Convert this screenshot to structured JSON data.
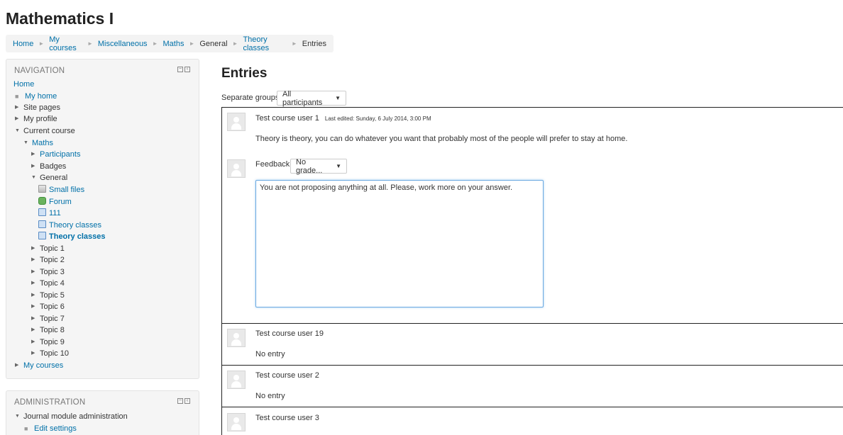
{
  "page_title": "Mathematics I",
  "breadcrumb": {
    "items": [
      "Home",
      "My courses",
      "Miscellaneous",
      "Maths",
      "General",
      "Theory classes",
      "Entries"
    ],
    "separator": "►"
  },
  "navigation": {
    "title": "NAVIGATION",
    "home": "Home",
    "my_home": "My home",
    "site_pages": "Site pages",
    "my_profile": "My profile",
    "current_course": "Current course",
    "maths": "Maths",
    "participants": "Participants",
    "badges": "Badges",
    "general": "General",
    "small_files": "Small files",
    "forum": "Forum",
    "item_111": "111",
    "theory_classes_1": "Theory classes",
    "theory_classes_2": "Theory classes",
    "topics": [
      "Topic 1",
      "Topic 2",
      "Topic 3",
      "Topic 4",
      "Topic 5",
      "Topic 6",
      "Topic 7",
      "Topic 8",
      "Topic 9",
      "Topic 10"
    ],
    "my_courses": "My courses"
  },
  "administration": {
    "title": "ADMINISTRATION",
    "journal_admin": "Journal module administration",
    "edit_settings": "Edit settings"
  },
  "main": {
    "heading": "Entries",
    "group_label": "Separate groups",
    "group_value": "All participants",
    "entries": [
      {
        "user": "Test course user 1",
        "last_edited": "Last edited: Sunday, 6 July 2014, 3:00 PM",
        "text": "Theory is theory, you can do whatever you want that probably most of the people will prefer to stay at home.",
        "feedback_label": "Feedback:",
        "grade_value": "No grade...",
        "feedback_text": "You are not proposing anything at all. Please, work more on your answer."
      },
      {
        "user": "Test course user 19",
        "text": "No entry"
      },
      {
        "user": "Test course user 2",
        "text": "No entry"
      },
      {
        "user": "Test course user 3"
      }
    ]
  },
  "colors": {
    "link": "#0070a8",
    "focus_border": "#6aa8e0"
  }
}
